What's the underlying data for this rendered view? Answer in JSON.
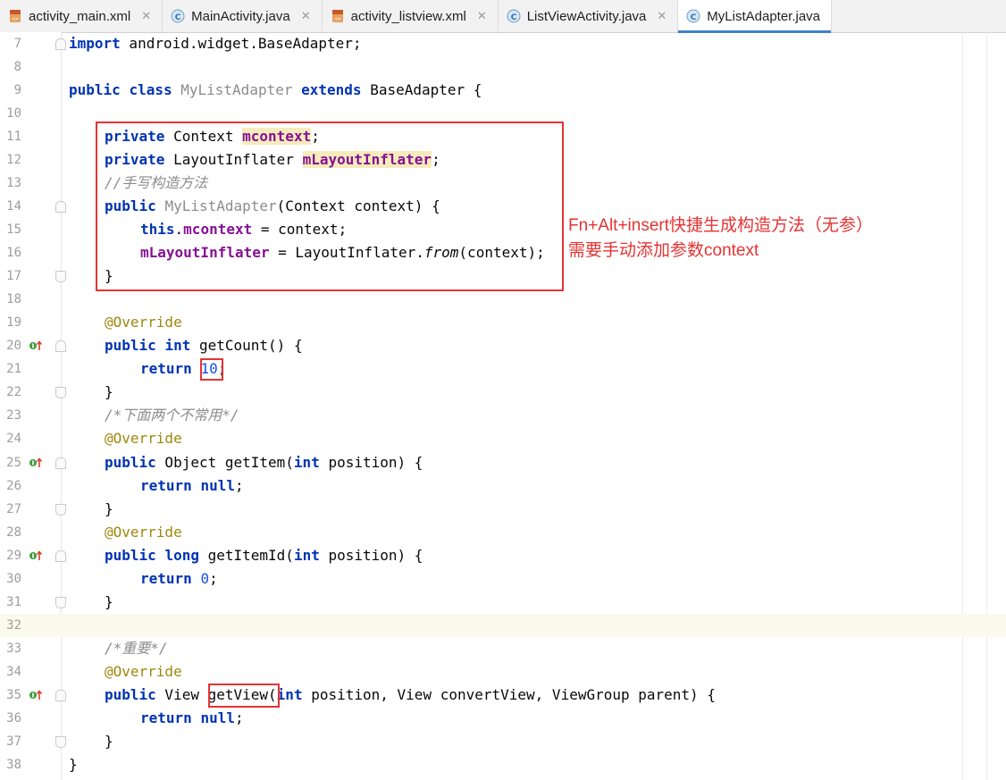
{
  "tabs": [
    {
      "label": "activity_main.xml",
      "icon": "xml-file-icon",
      "active": false
    },
    {
      "label": "MainActivity.java",
      "icon": "java-class-icon",
      "active": false
    },
    {
      "label": "activity_listview.xml",
      "icon": "xml-file-icon",
      "active": false
    },
    {
      "label": "ListViewActivity.java",
      "icon": "java-class-icon",
      "active": false
    },
    {
      "label": "MyListAdapter.java",
      "icon": "java-class-icon",
      "active": true
    }
  ],
  "line_numbers": [
    "7",
    "8",
    "9",
    "10",
    "11",
    "12",
    "13",
    "14",
    "15",
    "16",
    "17",
    "18",
    "19",
    "20",
    "21",
    "22",
    "23",
    "24",
    "25",
    "26",
    "27",
    "28",
    "29",
    "30",
    "31",
    "32",
    "33",
    "34",
    "35",
    "36",
    "37",
    "38"
  ],
  "code": {
    "l7_import": "import",
    "l7_rest": " android.widget.BaseAdapter;",
    "l9_public": "public",
    "l9_class": "class",
    "l9_name": "MyListAdapter",
    "l9_extends": "extends",
    "l9_rest": " BaseAdapter {",
    "l11_private": "private",
    "l11_type": " Context ",
    "l11_field": "mcontext",
    "l11_end": ";",
    "l12_private": "private",
    "l12_type": " LayoutInflater ",
    "l12_field": "mLayoutInflater",
    "l12_end": ";",
    "l13_comment": "//手写构造方法",
    "l14_public": "public",
    "l14_name": "MyListAdapter",
    "l14_rest": "(Context context) {",
    "l15_this": "this",
    "l15_dot": ".",
    "l15_field": "mcontext",
    "l15_rest": " = context;",
    "l16_field": "mLayoutInflater",
    "l16_mid": " = LayoutInflater.",
    "l16_from": "from",
    "l16_rest": "(context);",
    "close_brace": "}",
    "override": "@Override",
    "l20_public": "public",
    "l20_int": "int",
    "l20_rest": " getCount() {",
    "return": "return",
    "l21_num": "10",
    "l21_end": ";",
    "l23_comment": "/*下面两个不常用*/",
    "l25_public": "public",
    "l25_mid": " Object getItem(",
    "l25_int": "int",
    "l25_rest": " position) {",
    "null": "null",
    "semicolon": ";",
    "l29_public": "public",
    "l29_long": "long",
    "l29_mid": " getItemId(",
    "l29_int": "int",
    "l29_rest": " position) {",
    "l30_num": "0",
    "l33_comment": "/*重要*/",
    "l35_public": "public",
    "l35_type": " View ",
    "l35_method": "getView",
    "l35_paren": "(",
    "l35_int": "int",
    "l35_rest": " position, View convertView, ViewGroup parent) {",
    "l38_brace": "}"
  },
  "annotation": {
    "line1": "Fn+Alt+insert快捷生成构造方法（无参）",
    "line2": "需要手动添加参数context"
  },
  "colors": {
    "keyword": "#0033b3",
    "field": "#871094",
    "annotation": "#9e880d",
    "number": "#1750eb",
    "comment": "#8c8c8c",
    "highlight_box": "#e53333",
    "current_line": "#fcfaed"
  }
}
